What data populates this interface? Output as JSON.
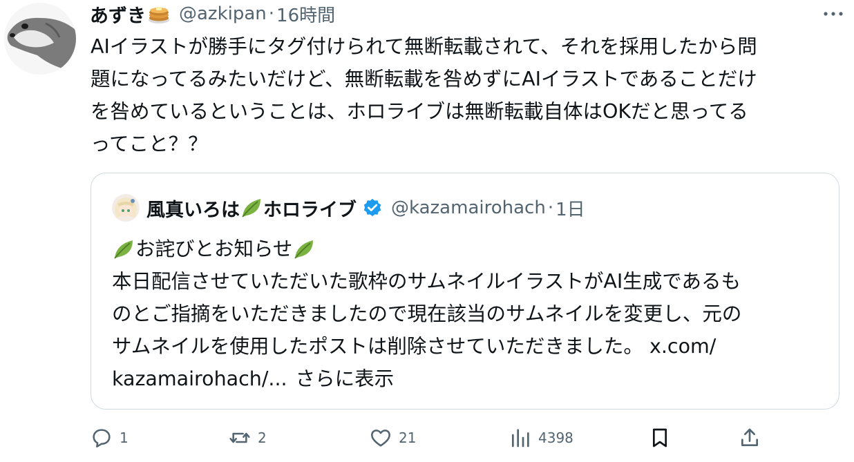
{
  "author": {
    "display_name": "あずき",
    "handle": "@azkipan",
    "separator": "·",
    "time": "16時間",
    "emoji": "pancakes-icon"
  },
  "tweet_lines": [
    "AIイラストが勝手にタグ付けられて無断転載されて、それを採用したから問",
    "題になってるみたいだけど、無断転載を咎めずにAIイラストであることだけ",
    "を咎めているということは、ホロライブは無断転載自体はOKだと思ってる",
    "ってこと？？"
  ],
  "quote": {
    "display_name": "風真いろは",
    "display_name_suffix": "ホロライブ",
    "handle": "@kazamairohach",
    "separator": "·",
    "time": "1日",
    "verified": true,
    "headline": "お詫びとお知らせ",
    "lines": [
      "本日配信させていただいた歌枠のサムネイルイラストがAI生成であるも",
      "のとご指摘をいただきましたので現在該当のサムネイルを変更し、元の",
      "サムネイルを使用したポストは削除させていただきました。 x.com/"
    ],
    "last_line_prefix": "kazamairohach/...",
    "show_more": "さらに表示"
  },
  "actions": {
    "reply_count": "1",
    "repost_count": "2",
    "like_count": "21",
    "view_count": "4398"
  },
  "colors": {
    "text": "#0f1419",
    "secondary": "#536471",
    "border": "#cfd9de",
    "verified": "#1d9bf0"
  }
}
